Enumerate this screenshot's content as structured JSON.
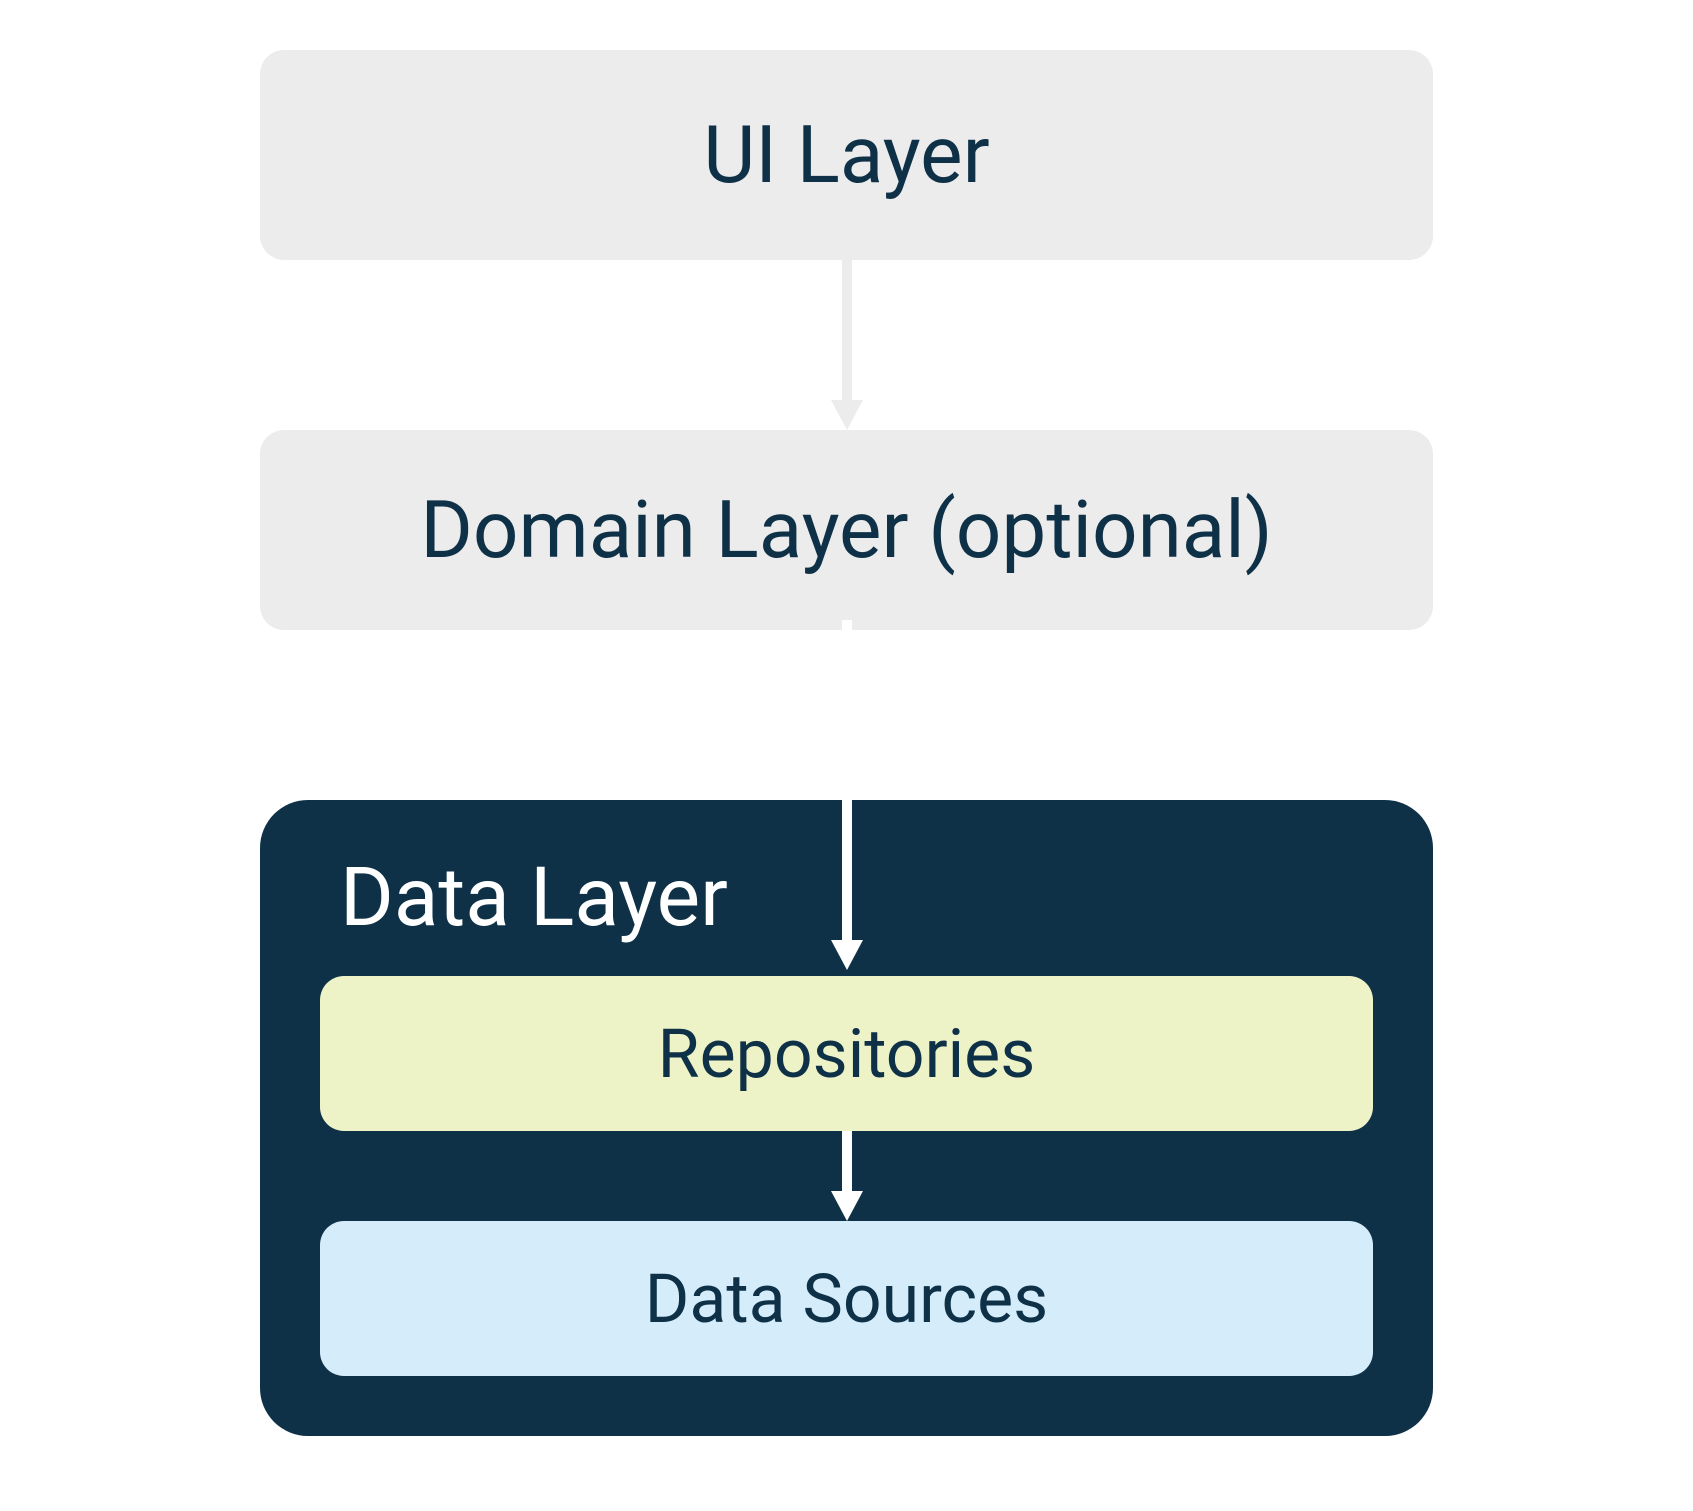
{
  "layers": {
    "ui": "UI Layer",
    "domain": "Domain Layer (optional)",
    "data": {
      "title": "Data Layer",
      "repositories": "Repositories",
      "dataSources": "Data Sources"
    }
  },
  "colors": {
    "lightGray": "#ececec",
    "darkBlue": "#0e3147",
    "lightYellow": "#eef3c7",
    "lightBlue": "#d5ecfb",
    "white": "#ffffff"
  }
}
